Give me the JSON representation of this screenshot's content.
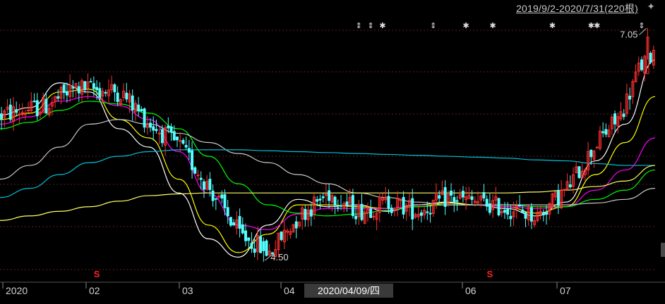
{
  "header": {
    "range_label": "2019/9/2-2020/7/31(220根)",
    "pin_icon": "pin-icon"
  },
  "crosshair_date_label": "2020/04/09/四",
  "annotations": {
    "high_label": "7.05",
    "low_label": "4.50",
    "signal_marker_text": "S"
  },
  "colors": {
    "background": "#000000",
    "up_candle": "#ff3030",
    "down_candle": "#54ffff",
    "ma5": "#ffffff",
    "ma10": "#ffff00",
    "ma20": "#ff00ff",
    "ma60": "#00ff00",
    "ma120": "#c8c8c8",
    "ma250": "#00c0d8",
    "ma500": "#ffff66",
    "grid": "#5a2020",
    "axis_text": "#d0d0d0",
    "signal": "#ff2020"
  },
  "chart_data": {
    "type": "candlestick",
    "title": "",
    "period": "2019/9/2-2020/7/31",
    "bar_count": 220,
    "x_tick_labels": [
      "2020",
      "02",
      "03",
      "04",
      "06",
      "07"
    ],
    "price_extremes": {
      "high": 7.05,
      "low": 4.5
    },
    "ylim": [
      4.3,
      7.2
    ],
    "series_descriptions": [
      "MA5",
      "MA10",
      "MA20",
      "MA60",
      "MA120",
      "MA250",
      "MA500"
    ],
    "moving_averages": [
      {
        "color": "#ffffff",
        "values": [
          6.1,
          6.18,
          6.45,
          6.35,
          5.95,
          5.75,
          5.25,
          4.75,
          4.55,
          4.9,
          5.18,
          5.1,
          5.12,
          5.05,
          5.12,
          5.15,
          5.12,
          5.08,
          5.0,
          5.15,
          5.6,
          6.0,
          6.7
        ]
      },
      {
        "color": "#ffff00",
        "values": [
          6.05,
          6.12,
          6.35,
          6.38,
          6.05,
          5.85,
          5.4,
          4.9,
          4.6,
          4.8,
          5.12,
          5.12,
          5.1,
          5.08,
          5.1,
          5.14,
          5.12,
          5.1,
          5.03,
          5.1,
          5.45,
          5.8,
          6.3
        ]
      },
      {
        "color": "#ff00ff",
        "values": [
          6.0,
          6.08,
          6.25,
          6.3,
          6.2,
          6.05,
          5.7,
          5.25,
          4.9,
          4.85,
          5.02,
          5.08,
          5.08,
          5.08,
          5.1,
          5.12,
          5.12,
          5.1,
          5.08,
          5.1,
          5.28,
          5.5,
          5.85
        ]
      },
      {
        "color": "#00ff00",
        "values": [
          5.95,
          6.02,
          6.15,
          6.25,
          6.22,
          6.12,
          5.95,
          5.65,
          5.35,
          5.12,
          5.03,
          5.0,
          5.02,
          5.06,
          5.1,
          5.12,
          5.12,
          5.12,
          5.1,
          5.1,
          5.18,
          5.28,
          5.5
        ]
      },
      {
        "color": "#c8c8c8",
        "values": [
          5.4,
          5.55,
          5.75,
          6.0,
          6.05,
          6.0,
          5.9,
          5.8,
          5.68,
          5.58,
          5.45,
          5.35,
          5.25,
          5.2,
          5.15,
          5.12,
          5.12,
          5.12,
          5.12,
          5.12,
          5.14,
          5.18,
          5.3
        ]
      },
      {
        "color": "#00c0d8",
        "values": [
          5.2,
          5.3,
          5.45,
          5.58,
          5.65,
          5.7,
          5.72,
          5.72,
          5.72,
          5.71,
          5.7,
          5.69,
          5.68,
          5.67,
          5.66,
          5.65,
          5.64,
          5.63,
          5.61,
          5.6,
          5.57,
          5.55,
          5.55
        ]
      },
      {
        "color": "#ffff66",
        "values": [
          4.95,
          5.0,
          5.05,
          5.1,
          5.16,
          5.22,
          5.24,
          5.25,
          5.25,
          5.25,
          5.25,
          5.25,
          5.25,
          5.25,
          5.25,
          5.25,
          5.25,
          5.25,
          5.26,
          5.28,
          5.32,
          5.38,
          5.55
        ]
      }
    ]
  }
}
